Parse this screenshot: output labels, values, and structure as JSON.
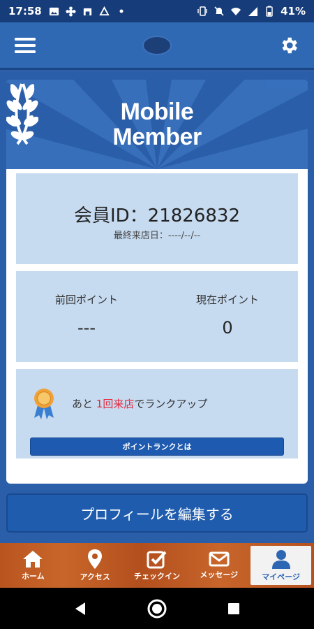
{
  "status_bar": {
    "time": "17:58",
    "battery": "41%"
  },
  "header": {
    "menu_icon": "hamburger-icon",
    "settings_icon": "gear-icon"
  },
  "banner": {
    "title_line1": "Mobile",
    "title_line2": "Member"
  },
  "member": {
    "id_label": "会員ID：21826832",
    "last_visit": "最終来店日：----/--/--"
  },
  "points": {
    "prev_label": "前回ポイント",
    "prev_value": "---",
    "current_label": "現在ポイント",
    "current_value": "0"
  },
  "rank": {
    "prefix": "あと ",
    "highlight": "1回来店",
    "suffix": "でランクアップ",
    "button_label": "ポイントランクとは"
  },
  "profile_button": "プロフィールを編集する",
  "tabs": [
    {
      "label": "ホーム",
      "icon": "home-icon"
    },
    {
      "label": "アクセス",
      "icon": "map-pin-icon"
    },
    {
      "label": "チェックイン",
      "icon": "checkin-icon"
    },
    {
      "label": "メッセージ",
      "icon": "mail-icon"
    },
    {
      "label": "マイページ",
      "icon": "user-icon",
      "active": true
    }
  ],
  "colors": {
    "primary": "#2f68b3",
    "panel": "#c6daf0",
    "highlight": "#e6283c",
    "tab_wood": "#b9541f"
  }
}
